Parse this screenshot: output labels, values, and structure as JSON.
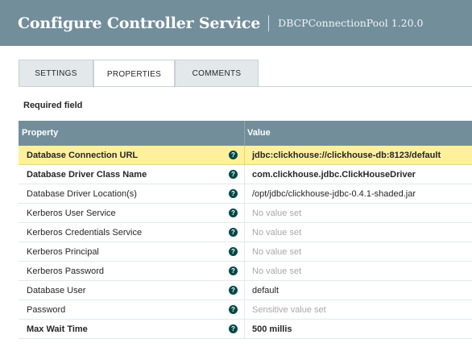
{
  "dialog": {
    "title": "Configure Controller Service",
    "subtitle": "DBCPConnectionPool 1.20.0"
  },
  "tabs": [
    {
      "label": "SETTINGS",
      "active": false
    },
    {
      "label": "PROPERTIES",
      "active": true
    },
    {
      "label": "COMMENTS",
      "active": false
    }
  ],
  "required_label": "Required field",
  "grid": {
    "headers": {
      "property": "Property",
      "value": "Value"
    },
    "help_glyph": "?",
    "rows": [
      {
        "name": "Database Connection URL",
        "value": "jdbc:clickhouse://clickhouse-db:8123/default",
        "required": true,
        "state": "set"
      },
      {
        "name": "Database Driver Class Name",
        "value": "com.clickhouse.jdbc.ClickHouseDriver",
        "required": true,
        "state": "set"
      },
      {
        "name": "Database Driver Location(s)",
        "value": "/opt/jdbc/clickhouse-jdbc-0.4.1-shaded.jar",
        "required": false,
        "state": "set"
      },
      {
        "name": "Kerberos User Service",
        "value": "No value set",
        "required": false,
        "state": "empty"
      },
      {
        "name": "Kerberos Credentials Service",
        "value": "No value set",
        "required": false,
        "state": "empty"
      },
      {
        "name": "Kerberos Principal",
        "value": "No value set",
        "required": false,
        "state": "empty"
      },
      {
        "name": "Kerberos Password",
        "value": "No value set",
        "required": false,
        "state": "empty"
      },
      {
        "name": "Database User",
        "value": "default",
        "required": false,
        "state": "set"
      },
      {
        "name": "Password",
        "value": "Sensitive value set",
        "required": false,
        "state": "sensitive"
      },
      {
        "name": "Max Wait Time",
        "value": "500 millis",
        "required": true,
        "state": "set"
      }
    ]
  },
  "colors": {
    "header_bg": "#728e9b",
    "highlight_row": "#fff09c",
    "help_icon": "#004849"
  }
}
